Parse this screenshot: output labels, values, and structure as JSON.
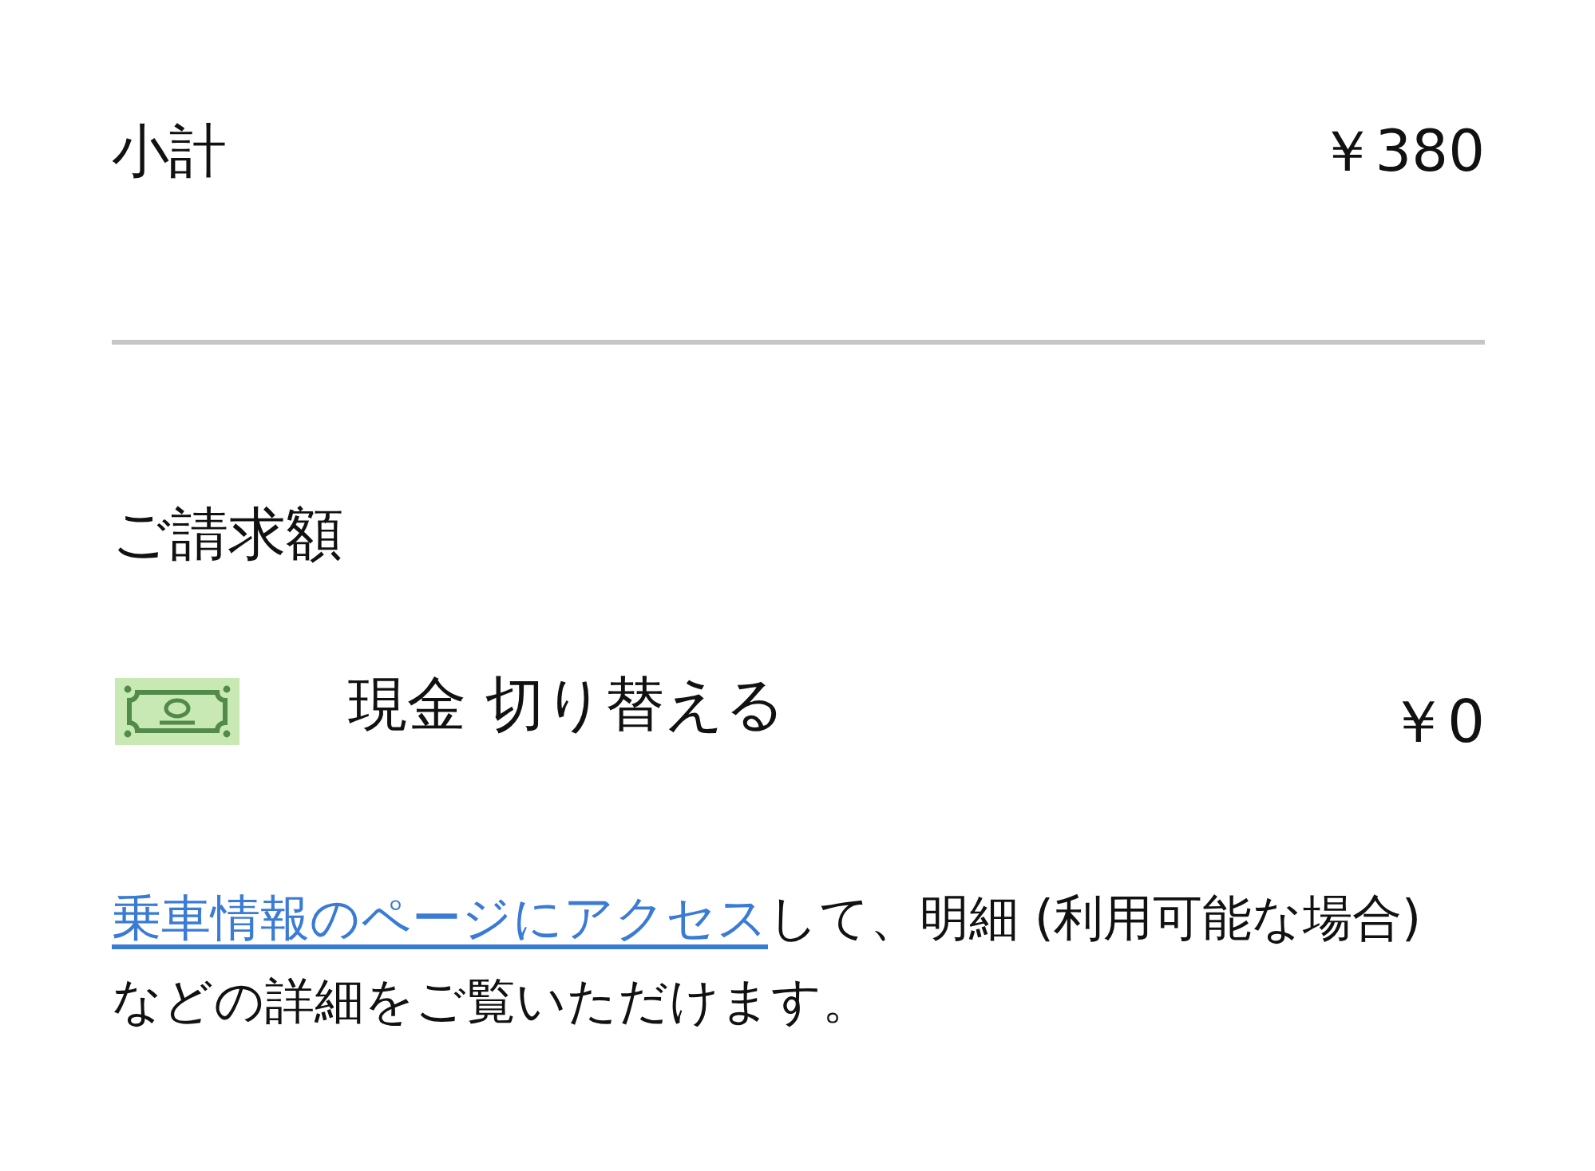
{
  "subtotal": {
    "label": "小計",
    "amount": "￥380"
  },
  "charge": {
    "title": "ご請求額",
    "payment": {
      "label": "現金 切り替える",
      "amount": "￥0"
    }
  },
  "note": {
    "link": "乗車情報のページにアクセス",
    "text": "して、明細 (利用可能な場合) などの詳細をご覧いただけます。"
  }
}
